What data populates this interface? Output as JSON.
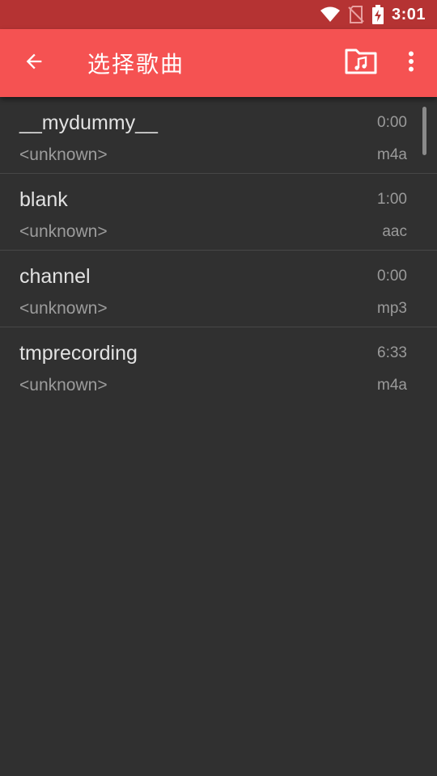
{
  "status_bar": {
    "time": "3:01",
    "icons": [
      "wifi-icon",
      "no-sim-icon",
      "battery-charging-icon"
    ]
  },
  "app_bar": {
    "title": "选择歌曲",
    "back_icon": "arrow-back-icon",
    "folder_icon": "music-folder-icon",
    "more_icon": "more-vert-icon"
  },
  "songs": [
    {
      "title": "__mydummy__",
      "duration": "0:00",
      "artist": "<unknown>",
      "format": "m4a"
    },
    {
      "title": "blank",
      "duration": "1:00",
      "artist": "<unknown>",
      "format": "aac"
    },
    {
      "title": "channel",
      "duration": "0:00",
      "artist": "<unknown>",
      "format": "mp3"
    },
    {
      "title": "tmprecording",
      "duration": "6:33",
      "artist": "<unknown>",
      "format": "m4a"
    }
  ],
  "colors": {
    "status_bar": "#b53333",
    "app_bar": "#f55252",
    "background": "#303030"
  }
}
